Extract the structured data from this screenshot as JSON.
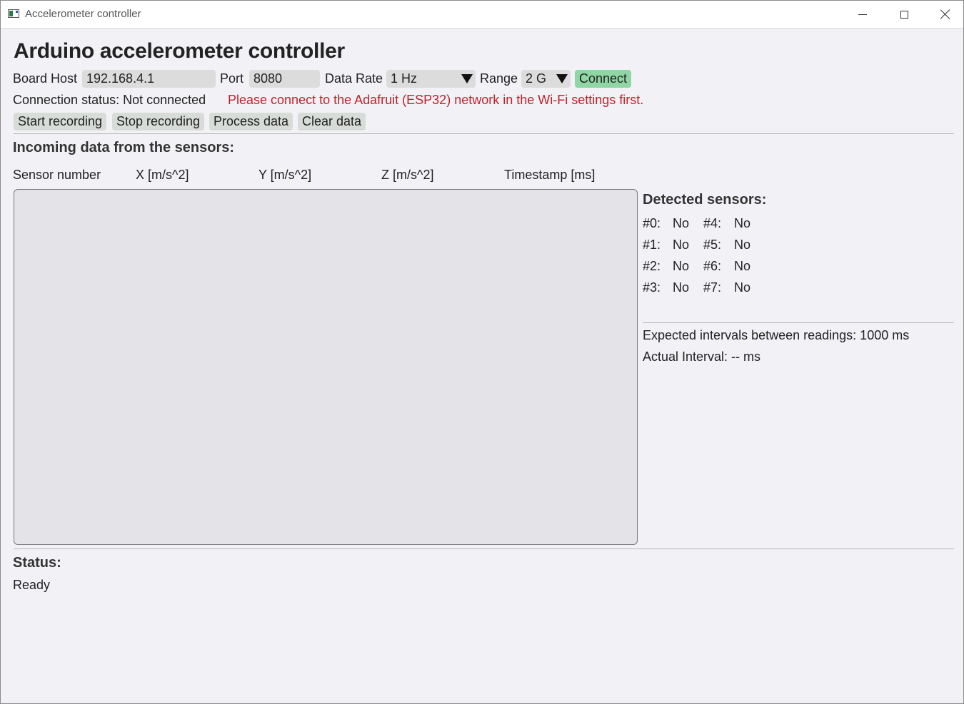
{
  "window": {
    "title": "Accelerometer controller"
  },
  "page_title": "Arduino accelerometer controller",
  "connection": {
    "board_host_label": "Board Host",
    "board_host_value": "192.168.4.1",
    "port_label": "Port",
    "port_value": "8080",
    "data_rate_label": "Data Rate",
    "data_rate_value": "1 Hz",
    "range_label": "Range",
    "range_value": "2 G",
    "connect_label": "Connect",
    "status_text": "Connection status: Not connected",
    "warning_text": "Please connect to the Adafruit (ESP32) network in the Wi-Fi settings first."
  },
  "actions": {
    "start_recording": "Start recording",
    "stop_recording": "Stop recording",
    "process_data": "Process data",
    "clear_data": "Clear data"
  },
  "incoming": {
    "heading": "Incoming data from the sensors:",
    "columns": [
      "Sensor number",
      "X [m/s^2]",
      "Y [m/s^2]",
      "Z [m/s^2]",
      "Timestamp [ms]"
    ]
  },
  "detected": {
    "heading": "Detected sensors:",
    "sensors": [
      {
        "label": "#0:",
        "value": "No"
      },
      {
        "label": "#1:",
        "value": "No"
      },
      {
        "label": "#2:",
        "value": "No"
      },
      {
        "label": "#3:",
        "value": "No"
      },
      {
        "label": "#4:",
        "value": "No"
      },
      {
        "label": "#5:",
        "value": "No"
      },
      {
        "label": "#6:",
        "value": "No"
      },
      {
        "label": "#7:",
        "value": "No"
      }
    ],
    "expected_interval": "Expected intervals between readings: 1000 ms",
    "actual_interval": "Actual Interval: -- ms"
  },
  "status": {
    "heading": "Status:",
    "value": "Ready"
  },
  "colors": {
    "background": "#f2f1f6",
    "connect_button": "#8fd6a4",
    "warning_text": "#c0232b",
    "field": "#dcdcdc"
  }
}
